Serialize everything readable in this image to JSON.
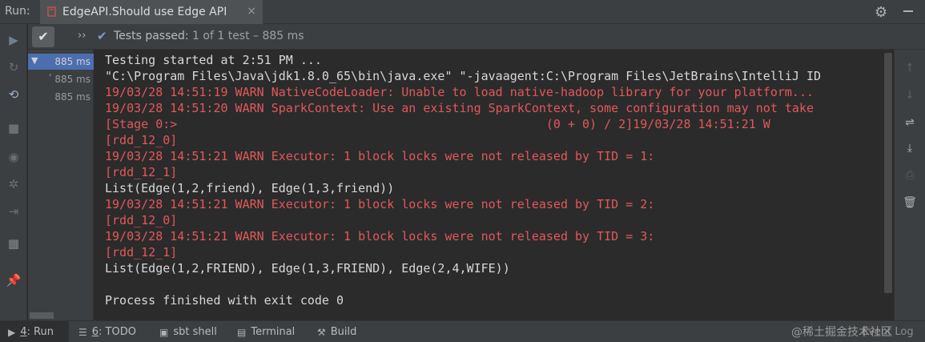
{
  "header": {
    "run_label": "Run:",
    "tab_title": "EdgeAPI.Should use Edge API",
    "close_glyph": "×"
  },
  "status": {
    "passed_text": "Tests passed:",
    "count_text": "1 of 1 test – 885 ms"
  },
  "tree": {
    "rows": [
      {
        "time": "885 ms"
      },
      {
        "time": "885 ms"
      },
      {
        "time": "885 ms"
      }
    ]
  },
  "console": {
    "lines": [
      {
        "type": "info",
        "text": "Testing started at 2:51 PM ..."
      },
      {
        "type": "info",
        "text": "\"C:\\Program Files\\Java\\jdk1.8.0_65\\bin\\java.exe\" \"-javaagent:C:\\Program Files\\JetBrains\\IntelliJ ID"
      },
      {
        "type": "warn",
        "text": "19/03/28 14:51:19 WARN NativeCodeLoader: Unable to load native-hadoop library for your platform..."
      },
      {
        "type": "warn",
        "text": "19/03/28 14:51:20 WARN SparkContext: Use an existing SparkContext, some configuration may not take"
      },
      {
        "type": "warn",
        "text": "[Stage 0:>                                                   (0 + 0) / 2]19/03/28 14:51:21 W"
      },
      {
        "type": "warn",
        "text": "[rdd_12_0]"
      },
      {
        "type": "warn",
        "text": "19/03/28 14:51:21 WARN Executor: 1 block locks were not released by TID = 1:"
      },
      {
        "type": "warn",
        "text": "[rdd_12_1]"
      },
      {
        "type": "info",
        "text": "List(Edge(1,2,friend), Edge(1,3,friend))"
      },
      {
        "type": "warn",
        "text": "19/03/28 14:51:21 WARN Executor: 1 block locks were not released by TID = 2:"
      },
      {
        "type": "warn",
        "text": "[rdd_12_0]"
      },
      {
        "type": "warn",
        "text": "19/03/28 14:51:21 WARN Executor: 1 block locks were not released by TID = 3:"
      },
      {
        "type": "warn",
        "text": "[rdd_12_1]"
      },
      {
        "type": "info",
        "text": "List(Edge(1,2,FRIEND), Edge(1,3,FRIEND), Edge(2,4,WIFE))"
      },
      {
        "type": "info",
        "text": ""
      },
      {
        "type": "info",
        "text": "Process finished with exit code 0"
      }
    ]
  },
  "bottom_bar": {
    "run": {
      "mnemonic": "4",
      "label": ": Run"
    },
    "todo": {
      "mnemonic": "6",
      "label": ": TODO"
    },
    "sbt": {
      "label": "sbt shell"
    },
    "terminal": {
      "label": "Terminal"
    },
    "build": {
      "label": "Build"
    },
    "event_log": {
      "label": "Event Log"
    }
  },
  "watermark": "@稀土掘金技术社区",
  "colors": {
    "background": "#2b2b2b",
    "panel": "#3c3f41",
    "warn": "#e35858",
    "selection": "#4b6eaf"
  }
}
